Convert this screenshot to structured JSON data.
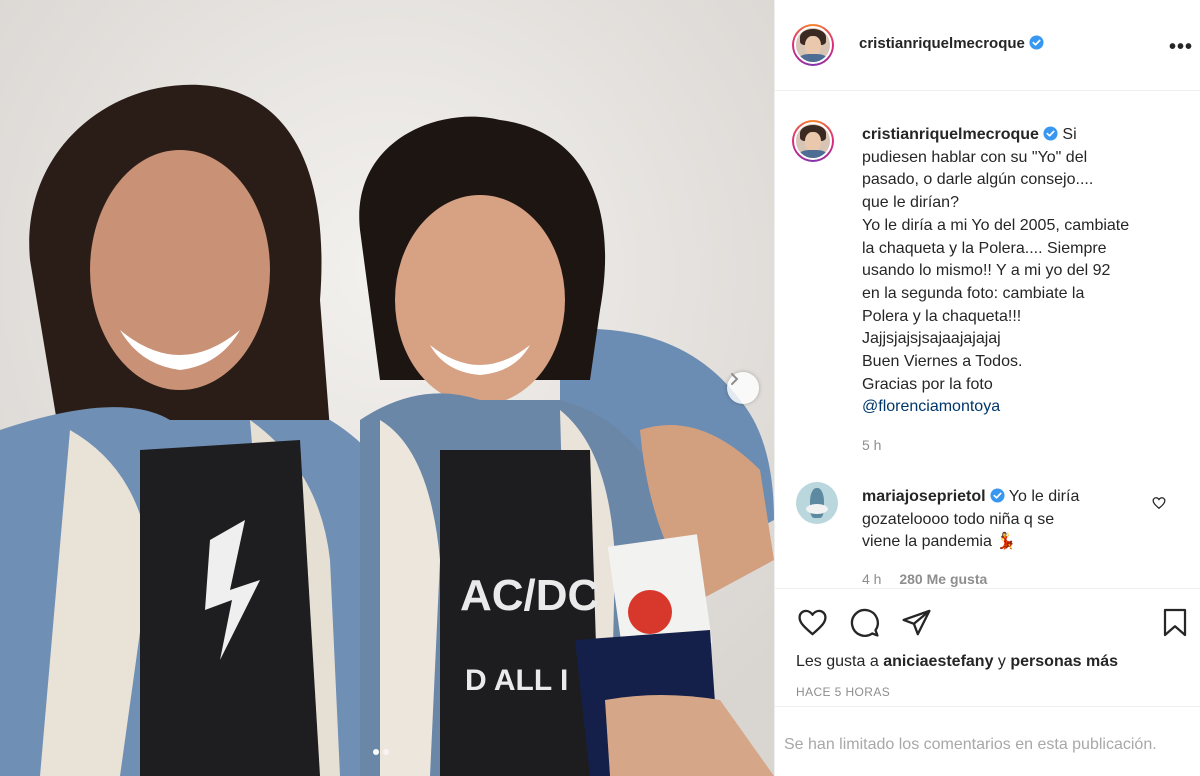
{
  "post": {
    "username": "cristianriquelmecroque",
    "more_icon": "more-options-icon",
    "caption_lines": [
      "Si",
      "pudiesen hablar con su \"Yo\" del",
      "pasado, o darle algún consejo....",
      "que le dirían?",
      "Yo le diría a mi Yo del 2005, cambiate",
      "la chaqueta y la Polera.... Siempre",
      "usando lo mismo!! Y a mi yo del 92",
      "en la segunda foto: cambiate la",
      "Polera y la chaqueta!!!",
      "Jajjsjajsjsajaajajajaj",
      "Buen Viernes a Todos.",
      "Gracias por la foto"
    ],
    "caption_mention": "@florenciamontoya",
    "caption_time": "5 h"
  },
  "comment": {
    "username": "mariajoseprietol",
    "text_lines": [
      "Yo le diría",
      "gozateloooo todo niña q se",
      "viene la pandemia"
    ],
    "emoji": "💃",
    "time": "4 h",
    "likes": "280 Me gusta"
  },
  "actions": {
    "likes_prefix": "Les gusta a",
    "likes_user": "aniciaestefany",
    "likes_mid": "y",
    "likes_suffix": "personas más",
    "post_time": "HACE 5 HORAS"
  },
  "footer": {
    "limited": "Se han limitado los comentarios en esta publicación."
  },
  "carousel": {
    "slides": 2,
    "active": 1
  },
  "colors": {
    "verified": "#3897f0",
    "mention": "#00376b",
    "muted": "#8e8e8e"
  }
}
